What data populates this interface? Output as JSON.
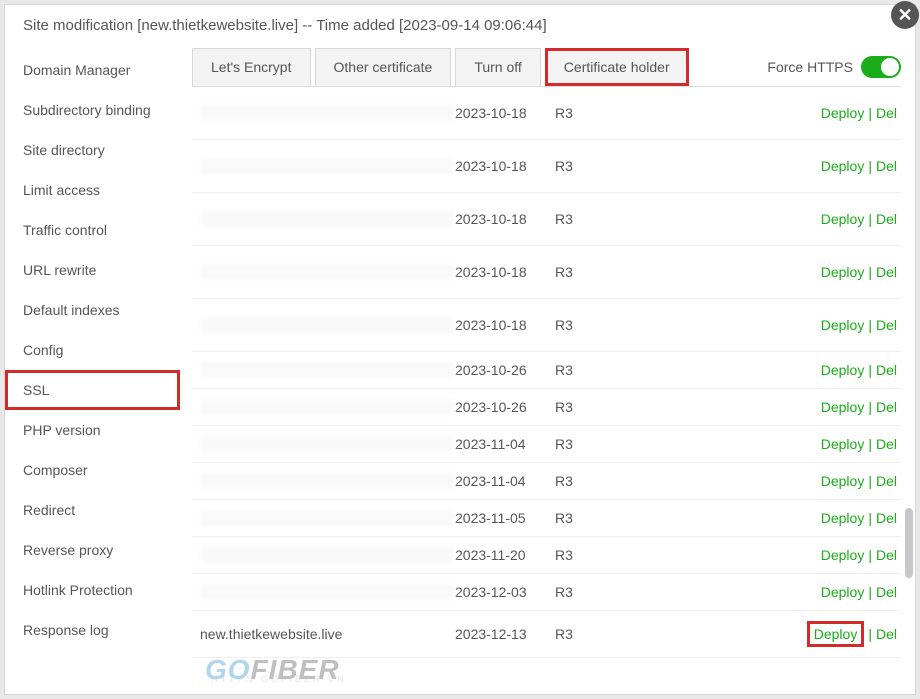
{
  "dialog": {
    "title": "Site modification [new.thietkewebsite.live] -- Time added [2023-09-14 09:06:44]"
  },
  "sidebar": {
    "items": [
      {
        "label": "Domain Manager",
        "active": false
      },
      {
        "label": "Subdirectory binding",
        "active": false
      },
      {
        "label": "Site directory",
        "active": false
      },
      {
        "label": "Limit access",
        "active": false
      },
      {
        "label": "Traffic control",
        "active": false
      },
      {
        "label": "URL rewrite",
        "active": false
      },
      {
        "label": "Default indexes",
        "active": false
      },
      {
        "label": "Config",
        "active": false
      },
      {
        "label": "SSL",
        "active": true
      },
      {
        "label": "PHP version",
        "active": false
      },
      {
        "label": "Composer",
        "active": false
      },
      {
        "label": "Redirect",
        "active": false
      },
      {
        "label": "Reverse proxy",
        "active": false
      },
      {
        "label": "Hotlink Protection",
        "active": false
      },
      {
        "label": "Response log",
        "active": false
      }
    ]
  },
  "tabs": [
    {
      "label": "Let's Encrypt",
      "active": false
    },
    {
      "label": "Other certificate",
      "active": false
    },
    {
      "label": "Turn off",
      "active": false
    },
    {
      "label": "Certificate holder",
      "active": true
    }
  ],
  "forceHttps": {
    "label": "Force HTTPS",
    "on": true
  },
  "actions": {
    "deploy": "Deploy",
    "del": "Del",
    "sep": "|"
  },
  "certs": [
    {
      "domain": "",
      "blurred": true,
      "tall": true,
      "date": "2023-10-18",
      "issuer": "R3"
    },
    {
      "domain": "",
      "blurred": true,
      "tall": true,
      "date": "2023-10-18",
      "issuer": "R3"
    },
    {
      "domain": "",
      "blurred": true,
      "tall": true,
      "date": "2023-10-18",
      "issuer": "R3"
    },
    {
      "domain": "",
      "blurred": true,
      "tall": true,
      "date": "2023-10-18",
      "issuer": "R3"
    },
    {
      "domain": "",
      "blurred": true,
      "tall": true,
      "date": "2023-10-18",
      "issuer": "R3"
    },
    {
      "domain": "",
      "blurred": true,
      "tall": false,
      "date": "2023-10-26",
      "issuer": "R3"
    },
    {
      "domain": "",
      "blurred": true,
      "tall": false,
      "date": "2023-10-26",
      "issuer": "R3"
    },
    {
      "domain": "",
      "blurred": true,
      "tall": false,
      "date": "2023-11-04",
      "issuer": "R3"
    },
    {
      "domain": "",
      "blurred": true,
      "tall": false,
      "date": "2023-11-04",
      "issuer": "R3"
    },
    {
      "domain": "",
      "blurred": true,
      "tall": false,
      "date": "2023-11-05",
      "issuer": "R3"
    },
    {
      "domain": "",
      "blurred": true,
      "tall": false,
      "date": "2023-11-20",
      "issuer": "R3"
    },
    {
      "domain": "",
      "blurred": true,
      "tall": false,
      "date": "2023-12-03",
      "issuer": "R3"
    },
    {
      "domain": "new.thietkewebsite.live",
      "blurred": false,
      "tall": false,
      "date": "2023-12-13",
      "issuer": "R3",
      "deployHighlight": true
    }
  ],
  "watermark": {
    "go": "GO",
    "fiber": "FIBER",
    "sub": "HTTPS   GOFIBER VN"
  }
}
